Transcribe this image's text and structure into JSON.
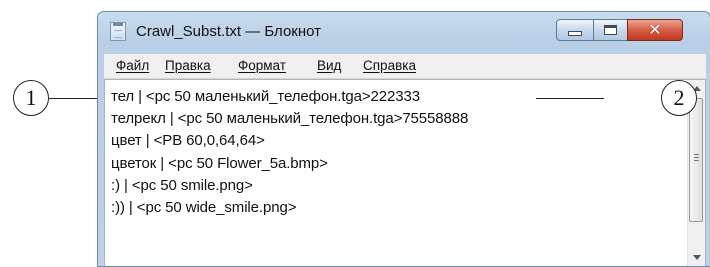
{
  "callouts": {
    "left": "1",
    "right": "2"
  },
  "window": {
    "title": "Crawl_Subst.txt — Блокнот",
    "close_symbol": "✕",
    "icon": "notepad-icon"
  },
  "menu": [
    "Файл",
    "Правка",
    "Формат",
    "Вид",
    "Справка"
  ],
  "lines": [
    "тел | <pc 50 маленький_телефон.tga>222333",
    "телрекл | <pc 50 маленький_телефон.tga>75558888",
    "цвет | <PB 60,0,64,64>",
    "цветок | <pc 50 Flower_5a.bmp>",
    ":) | <pc 50 smile.png>",
    ":)) | <pc 50 wide_smile.png>"
  ]
}
